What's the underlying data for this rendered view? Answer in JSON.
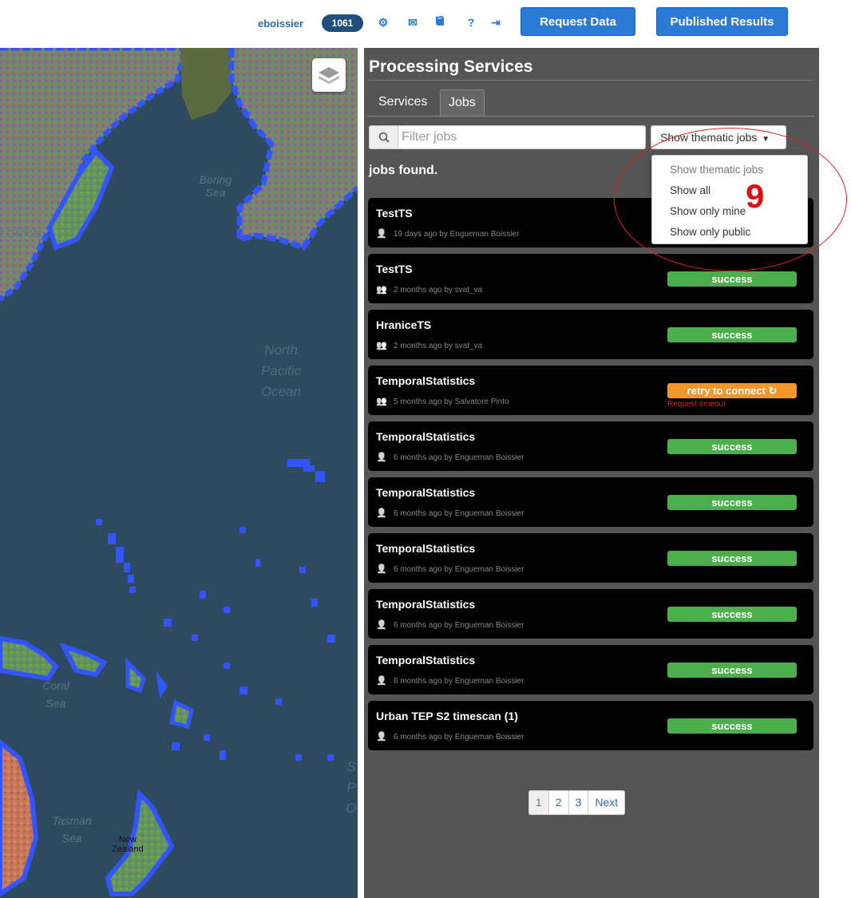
{
  "topbar": {
    "username": "eboissier",
    "badge": "1061",
    "icons": [
      "gear-icon",
      "envelope-icon",
      "book-icon",
      "question-icon",
      "sign-out-icon"
    ],
    "request_data": "Request Data",
    "published_results": "Published Results",
    "accent": "#2b7bd6"
  },
  "map": {
    "labels": {
      "bering": "Bering\nSea",
      "okhotsk": "f Okhots",
      "north_pacific": "North\nPacific\nOcean",
      "coral": "Coral\nSea",
      "tasman": "Tasman\nSea",
      "new_zealand": "New\nZealand",
      "edge_s": "S",
      "edge_p": "P",
      "edge_o": "O"
    }
  },
  "panel": {
    "title": "Processing Services",
    "tabs": [
      {
        "label": "Services",
        "active": false
      },
      {
        "label": "Jobs",
        "active": true
      }
    ],
    "filter_placeholder": "Filter jobs",
    "thematic_button": "Show thematic jobs",
    "jobs_found": "jobs found.",
    "jobs": [
      {
        "title": "TestTS",
        "meta": "19 days ago by Engueman Boissier",
        "owner_icon": "user-icon",
        "status": "",
        "error": ""
      },
      {
        "title": "TestTS",
        "meta": "2 months ago by svat_va",
        "owner_icon": "users-icon",
        "status": "success",
        "error": ""
      },
      {
        "title": "HraniceTS",
        "meta": "2 months ago by svat_va",
        "owner_icon": "users-icon",
        "status": "success",
        "error": ""
      },
      {
        "title": "TemporalStatistics",
        "meta": "5 months ago by Salvatore Pinto",
        "owner_icon": "users-icon",
        "status": "retry to connect ↻",
        "error": "Request timeout"
      },
      {
        "title": "TemporalStatistics",
        "meta": "6 months ago by Engueman Boissier",
        "owner_icon": "user-icon",
        "status": "success",
        "error": ""
      },
      {
        "title": "TemporalStatistics",
        "meta": "6 months ago by Engueman Boissier",
        "owner_icon": "user-icon",
        "status": "success",
        "error": ""
      },
      {
        "title": "TemporalStatistics",
        "meta": "6 months ago by Engueman Boissier",
        "owner_icon": "user-icon",
        "status": "success",
        "error": ""
      },
      {
        "title": "TemporalStatistics",
        "meta": "6 months ago by Engueman Boissier",
        "owner_icon": "user-icon",
        "status": "success",
        "error": ""
      },
      {
        "title": "TemporalStatistics",
        "meta": "6 months ago by Engueman Boissier",
        "owner_icon": "user-icon",
        "status": "success",
        "error": ""
      },
      {
        "title": "Urban TEP S2 timescan (1)",
        "meta": "6 months ago by Engueman Boissier",
        "owner_icon": "user-icon",
        "status": "success",
        "error": ""
      }
    ],
    "status_colors": {
      "success": "#4cae4c",
      "retry": "#f0962a",
      "error": "#e02020"
    },
    "pagination": [
      "1",
      "2",
      "3",
      "Next"
    ],
    "current_page": "1"
  },
  "dropdown": {
    "header": "Show thematic jobs",
    "items": [
      "Show all",
      "Show only mine",
      "Show only public"
    ]
  },
  "callout": {
    "number": "9",
    "color": "#e02020"
  }
}
